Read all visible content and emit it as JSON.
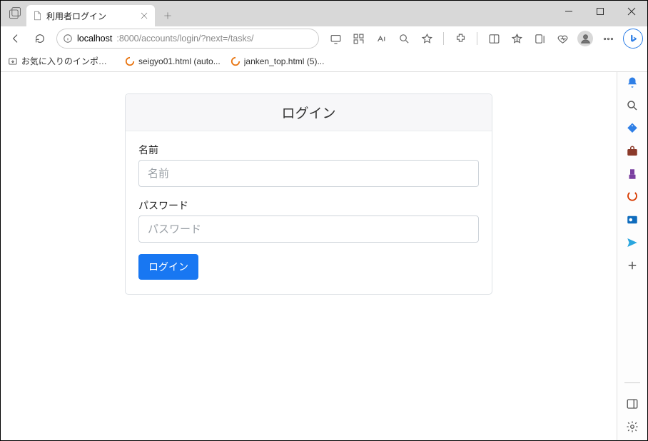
{
  "tab": {
    "title": "利用者ログイン"
  },
  "url": {
    "host": "localhost",
    "rest": ":8000/accounts/login/?next=/tasks/"
  },
  "bookmarks": {
    "import_label": "お気に入りのインポート",
    "items": [
      {
        "label": "seigyo01.html (auto..."
      },
      {
        "label": "janken_top.html (5)..."
      }
    ]
  },
  "login": {
    "header": "ログイン",
    "name_label": "名前",
    "name_placeholder": "名前",
    "password_label": "パスワード",
    "password_placeholder": "パスワード",
    "submit_label": "ログイン"
  }
}
